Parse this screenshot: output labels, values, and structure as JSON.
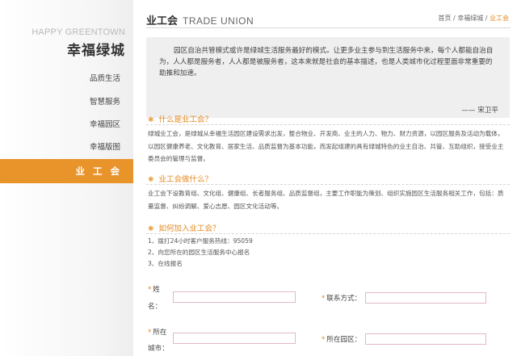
{
  "sidebar": {
    "brand_en": "HAPPY GREENTOWN",
    "brand_cn": "幸福绿城",
    "items": [
      {
        "label": "品质生活",
        "active": false
      },
      {
        "label": "智慧服务",
        "active": false
      },
      {
        "label": "幸福园区",
        "active": false
      },
      {
        "label": "幸福版图",
        "active": false
      },
      {
        "label": "业 工 会",
        "active": true
      }
    ]
  },
  "header": {
    "title_cn": "业工会",
    "title_en": "TRADE UNION",
    "breadcrumb": [
      "首页",
      "幸福绿城",
      "业工会"
    ],
    "separator": "/"
  },
  "quote": {
    "text": "园区自治共管模式或许是绿城生活服务最好的模式。让更多业主参与到生活服务中来，每个人都能自治自为，人人都是服务者，人人都是被服务者，这本来就是社会的基本描述，也是人类城市化过程里面非常重要的助推和加速。",
    "author": "—— 宋卫平"
  },
  "sections": [
    {
      "title": "什么是业工会？",
      "body": "绿城业工会，是绿城从幸福生活园区建设需求出发，整合物业、开发商、业主的人力、物力、财力资源，以园区服务及活动为载体，以园区健康养老、文化教育、居家生活、品质监督为基本功能，而发起组建的具有绿城特色的业主自治、共管、互助组织，接受业主委员会的管理与监督。"
    },
    {
      "title": "业工会做什么？",
      "body": "业工会下设教育组、文化组、健康组、长者服务组、品质监督组，主要工作职能为策划、组织实施园区生活服务相关工作，包括：质量监督、纠纷调解、爱心志愿、园区文化活动等。"
    },
    {
      "title": "如何加入业工会？",
      "items": [
        "1、拨打24小时客户服务热线：95059",
        "2、向您所在的园区生活服务中心报名",
        "3、在线报名"
      ]
    }
  ],
  "form": {
    "required_mark": "*",
    "name_label_1": "姓",
    "name_label_2": "名：",
    "contact_label": "联系方式：",
    "city_label_1": "所在",
    "city_label_2": "城市：",
    "park_label": "所在园区："
  },
  "colors": {
    "accent": "#e9932b",
    "input_border": "#e2b8c8"
  }
}
